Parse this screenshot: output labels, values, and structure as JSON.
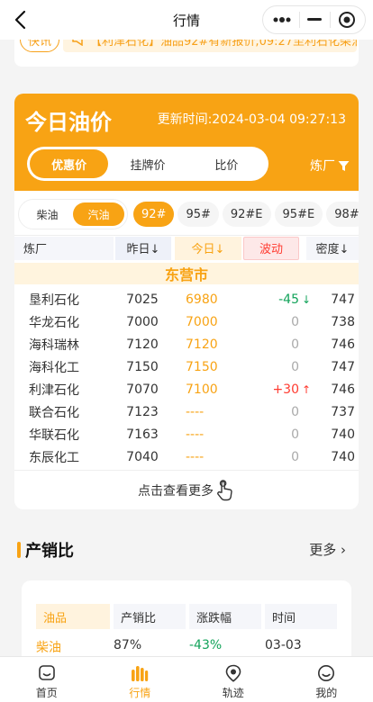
{
  "navbar": {
    "title": "行情"
  },
  "notice": {
    "tag": "快讯",
    "text": "【利津石化】油品92#有新报价,09:27至利石化柴油"
  },
  "price_card": {
    "title": "今日油价",
    "update_time": "更新时间:2024-03-04 09:27:13",
    "tabs": [
      "优惠价",
      "挂牌价",
      "比价"
    ],
    "filter_label": "炼厂",
    "fuel_types": [
      "柴油",
      "汽油"
    ],
    "grades": [
      "92#",
      "95#",
      "92#E",
      "95#E",
      "98#"
    ],
    "headers": {
      "refinery": "炼厂",
      "yesterday": "昨日↓",
      "today": "今日↓",
      "change": "波动",
      "density": "密度↓"
    },
    "city": "东营市",
    "rows": [
      {
        "name": "垦利石化",
        "yesterday": "7025",
        "today": "6980",
        "change": "-45",
        "arrow": "↓",
        "dir": "down",
        "density": "747"
      },
      {
        "name": "华龙石化",
        "yesterday": "7000",
        "today": "7000",
        "change": "0",
        "arrow": "",
        "dir": "flat",
        "density": "738"
      },
      {
        "name": "海科瑞林",
        "yesterday": "7120",
        "today": "7120",
        "change": "0",
        "arrow": "",
        "dir": "flat",
        "density": "746"
      },
      {
        "name": "海科化工",
        "yesterday": "7150",
        "today": "7150",
        "change": "0",
        "arrow": "",
        "dir": "flat",
        "density": "747"
      },
      {
        "name": "利津石化",
        "yesterday": "7070",
        "today": "7100",
        "change": "+30",
        "arrow": "↑",
        "dir": "up",
        "density": "746"
      },
      {
        "name": "联合石化",
        "yesterday": "7123",
        "today": "----",
        "change": "0",
        "arrow": "",
        "dir": "flat",
        "density": "737"
      },
      {
        "name": "华联石化",
        "yesterday": "7163",
        "today": "----",
        "change": "0",
        "arrow": "",
        "dir": "flat",
        "density": "740"
      },
      {
        "name": "东辰化工",
        "yesterday": "7040",
        "today": "----",
        "change": "0",
        "arrow": "",
        "dir": "flat",
        "density": "740"
      }
    ],
    "more_label": "点击查看更多"
  },
  "ratio": {
    "title": "产销比",
    "more_label": "更多",
    "headers": [
      "油品",
      "产销比",
      "涨跌幅",
      "时间"
    ],
    "row": {
      "product": "柴油",
      "ratio": "87%",
      "change": "-43%",
      "date": "03-03"
    }
  },
  "tabbar": {
    "items": [
      "首页",
      "行情",
      "轨迹",
      "我的"
    ],
    "active": "行情"
  },
  "colors": {
    "accent": "#f8a314",
    "up": "#ff3b30",
    "down": "#12a35a"
  }
}
